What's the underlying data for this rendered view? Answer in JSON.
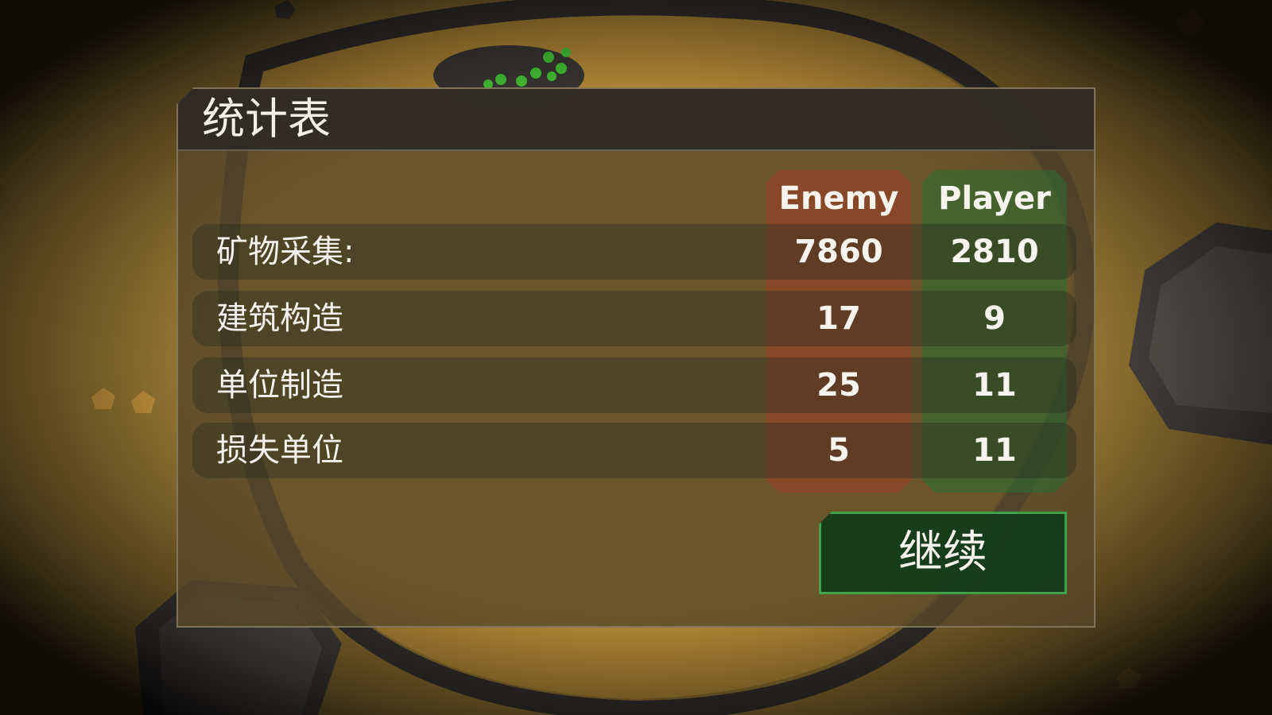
{
  "panel": {
    "title": "统计表"
  },
  "columns": {
    "enemy": "Enemy",
    "player": "Player"
  },
  "rows": [
    {
      "label": "矿物采集:",
      "enemy": "7860",
      "player": "2810"
    },
    {
      "label": "建筑构造",
      "enemy": "17",
      "player": "9"
    },
    {
      "label": "单位制造",
      "enemy": "25",
      "player": "11"
    },
    {
      "label": "损失单位",
      "enemy": "5",
      "player": "11"
    }
  ],
  "actions": {
    "continue_label": "继续"
  },
  "colors": {
    "enemy_column": "#9e3e28",
    "player_column": "#286e32",
    "button_border": "#3fa14a",
    "ground": "#b8892f",
    "rock": "#3b3835"
  }
}
